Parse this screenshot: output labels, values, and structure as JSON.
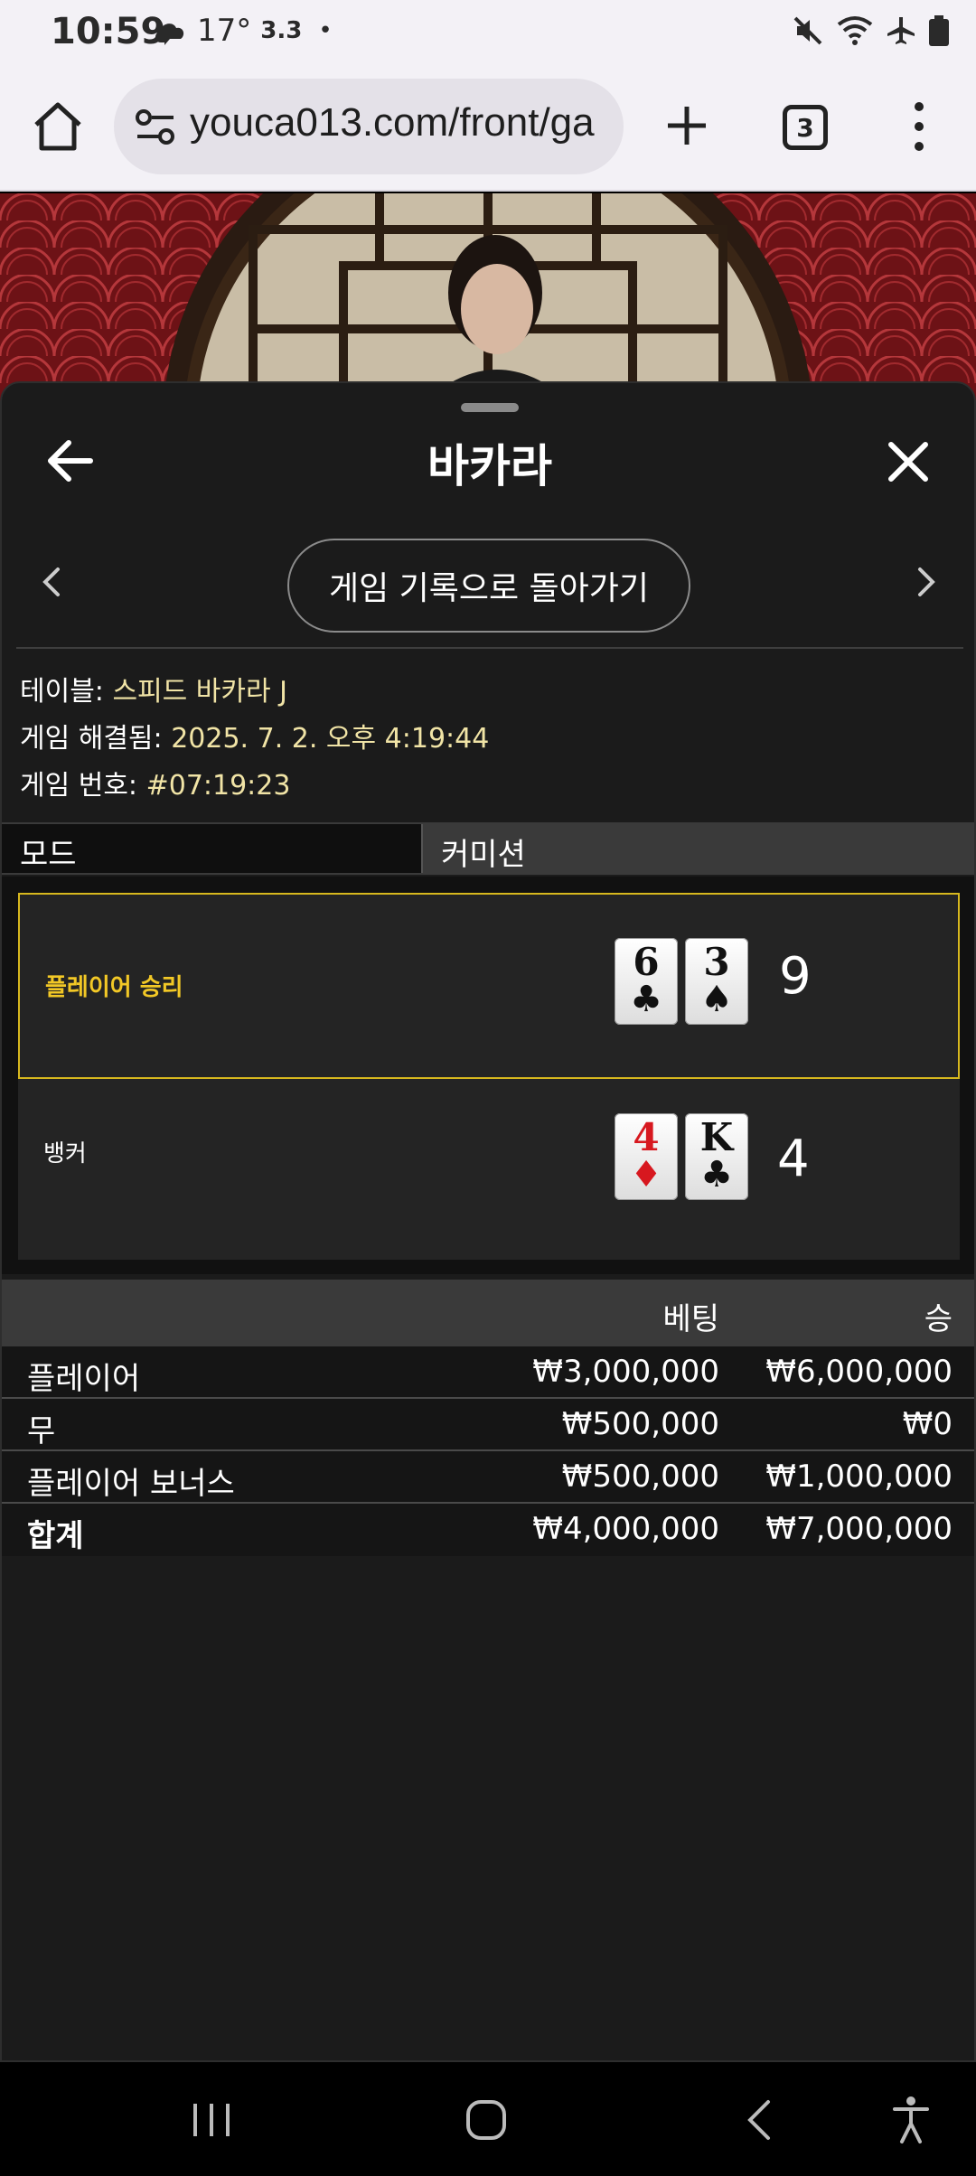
{
  "status_bar": {
    "time": "10:59",
    "temperature": "17°",
    "extra": "3.3",
    "dot": "•"
  },
  "browser": {
    "url": "youca013.com/front/ga",
    "tab_count": "3"
  },
  "sheet": {
    "title": "바카라",
    "back_to_history_label": "게임 기록으로 돌아가기",
    "info": {
      "table_label": "테이블: ",
      "table_value": "스피드 바카라 J",
      "resolved_label": "게임 해결됨: ",
      "resolved_value": "2025. 7. 2. 오후 4:19:44",
      "game_no_label": "게임 번호: ",
      "game_no_value": "#07:19:23"
    },
    "mode": {
      "label": "모드",
      "value": "커미션"
    },
    "results": {
      "player": {
        "label": "플레이어 승리",
        "cards": [
          {
            "rank": "6",
            "suit": "♣",
            "color": "black"
          },
          {
            "rank": "3",
            "suit": "♠",
            "color": "black"
          }
        ],
        "score": "9"
      },
      "banker": {
        "label": "뱅커",
        "cards": [
          {
            "rank": "4",
            "suit": "♦",
            "color": "red"
          },
          {
            "rank": "K",
            "suit": "♣",
            "color": "black"
          }
        ],
        "score": "4"
      }
    },
    "bet_table": {
      "headers": {
        "bet": "베팅",
        "win": "승"
      },
      "rows": [
        {
          "name": "플레이어",
          "bet": "₩3,000,000",
          "win": "₩6,000,000"
        },
        {
          "name": "무",
          "bet": "₩500,000",
          "win": "₩0"
        },
        {
          "name": "플레이어 보너스",
          "bet": "₩500,000",
          "win": "₩1,000,000"
        }
      ],
      "total": {
        "name": "합계",
        "bet": "₩4,000,000",
        "win": "₩7,000,000"
      }
    }
  },
  "colors": {
    "accent_gold": "#d7b81e",
    "info_value": "#f1e4a6",
    "sheet_bg": "#1b1b1b"
  }
}
